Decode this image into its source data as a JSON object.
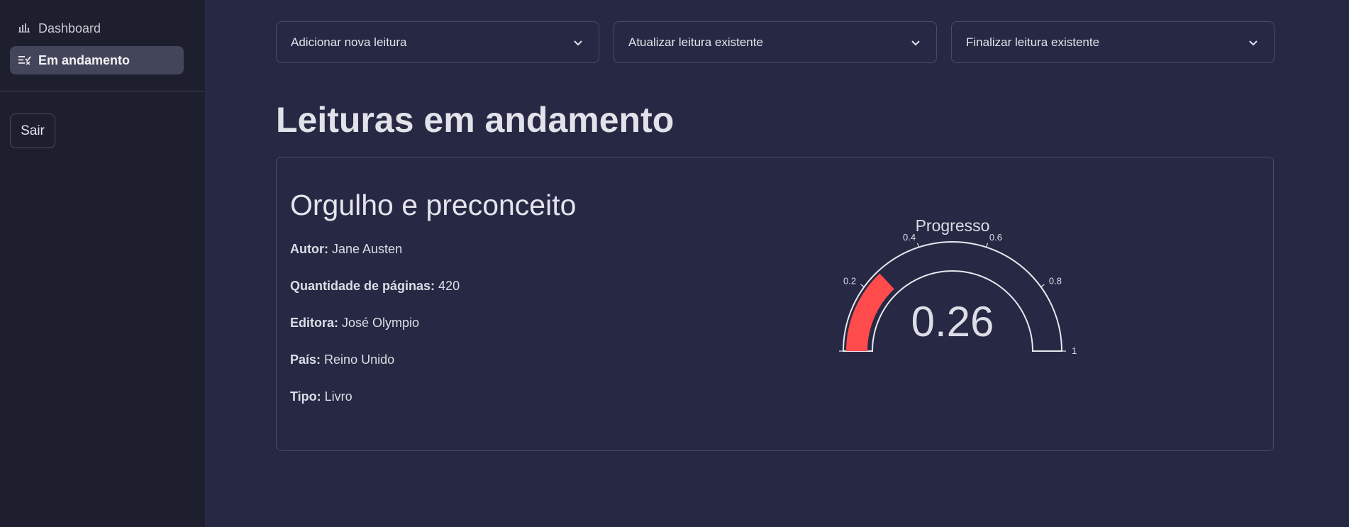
{
  "sidebar": {
    "items": [
      {
        "label": "Dashboard",
        "icon": "bar-chart-icon",
        "active": false
      },
      {
        "label": "Em andamento",
        "icon": "list-check-icon",
        "active": true
      }
    ],
    "logout_label": "Sair"
  },
  "toolbar": {
    "dropdowns": [
      {
        "label": "Adicionar nova leitura"
      },
      {
        "label": "Atualizar leitura existente"
      },
      {
        "label": "Finalizar leitura existente"
      }
    ]
  },
  "main": {
    "title": "Leituras em andamento",
    "book": {
      "title": "Orgulho e preconceito",
      "fields": [
        {
          "label": "Autor:",
          "value": "Jane Austen"
        },
        {
          "label": "Quantidade de páginas:",
          "value": "420"
        },
        {
          "label": "Editora:",
          "value": "José Olympio"
        },
        {
          "label": "País:",
          "value": "Reino Unido"
        },
        {
          "label": "Tipo:",
          "value": "Livro"
        }
      ]
    }
  },
  "chart_data": {
    "type": "gauge",
    "title": "Progresso",
    "value": 0.26,
    "display_value": "0.26",
    "range": [
      0,
      1
    ],
    "ticks": [
      0,
      0.2,
      0.4,
      0.6,
      0.8,
      1
    ],
    "tick_labels": [
      "0",
      "0.2",
      "0.4",
      "0.6",
      "0.8",
      "1"
    ],
    "bar_color": "#ff4b4b"
  },
  "colors": {
    "background": "#272944",
    "sidebar": "#1d1f2e",
    "accent": "#ff4b4b"
  }
}
